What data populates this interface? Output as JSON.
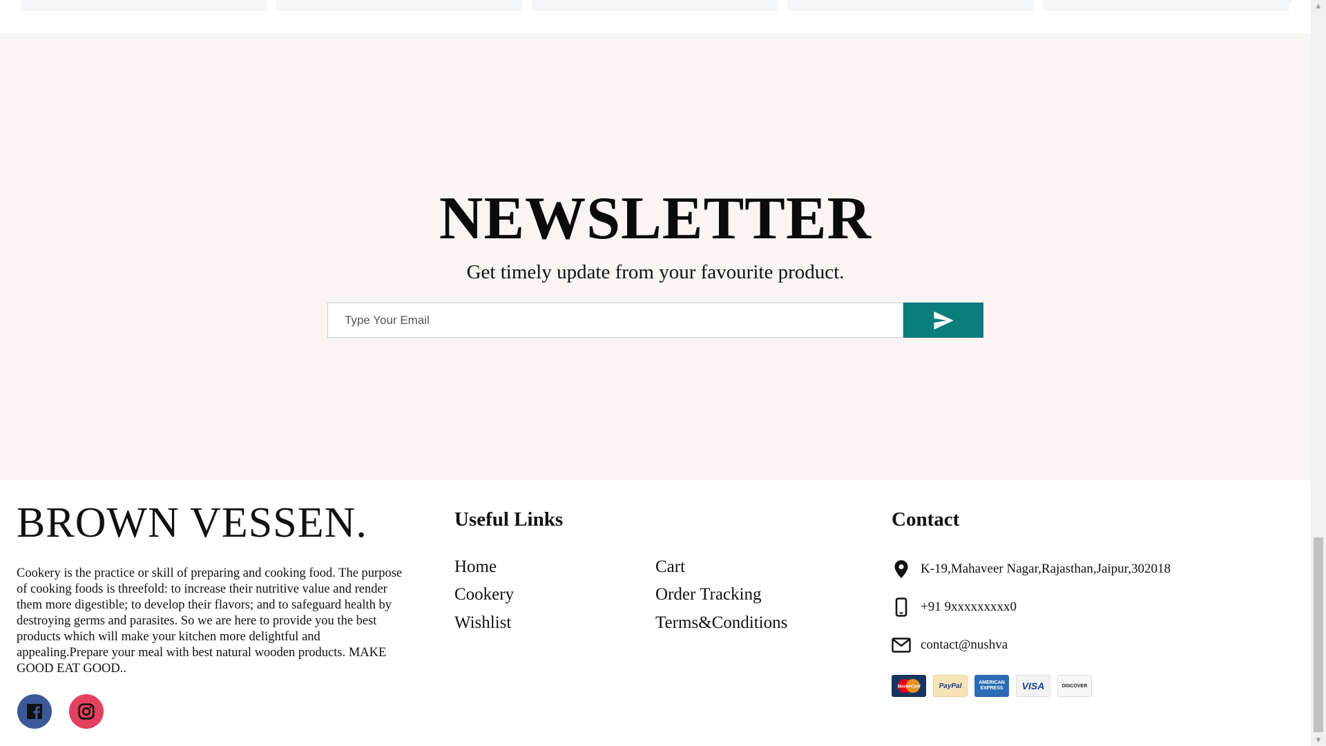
{
  "newsletter": {
    "title": "NEWSLETTER",
    "subtitle": "Get timely update from your favourite product.",
    "email_placeholder": "Type Your Email",
    "submit_icon": "send-icon",
    "button_color": "#0b7d7b",
    "background": "#faf4f4"
  },
  "footer": {
    "brand": "BROWN VESSEN.",
    "about": "Cookery is the practice or skill of preparing and cooking food. The purpose of cooking foods is threefold: to increase their nutritive value and render them more digestible; to develop their flavors; and to safeguard health by destroying germs and parasites. So we are here to provide you the best products which will make your kitchen more delightful and appealing.Prepare your meal with best natural wooden products. MAKE GOOD EAT GOOD..",
    "social": [
      {
        "icon": "facebook-icon",
        "color": "#3b5998"
      },
      {
        "icon": "instagram-icon",
        "color": "#e4405f"
      }
    ],
    "useful_links": {
      "title": "Useful Links",
      "items": [
        "Home",
        "Cookery",
        "Wishlist",
        "Cart",
        "Order Tracking",
        "Terms&Conditions"
      ]
    },
    "contact": {
      "title": "Contact",
      "address": "K-19,Mahaveer Nagar,Rajasthan,Jaipur,302018",
      "phone": "+91 9xxxxxxxxx0",
      "email": "contact@nushva",
      "address_icon": "location-pin-icon",
      "phone_icon": "mobile-phone-icon",
      "email_icon": "envelope-icon"
    },
    "payment_methods": [
      "MasterCard",
      "PayPal",
      "AMERICAN EXPRESS",
      "VISA",
      "DISCOVER"
    ]
  }
}
